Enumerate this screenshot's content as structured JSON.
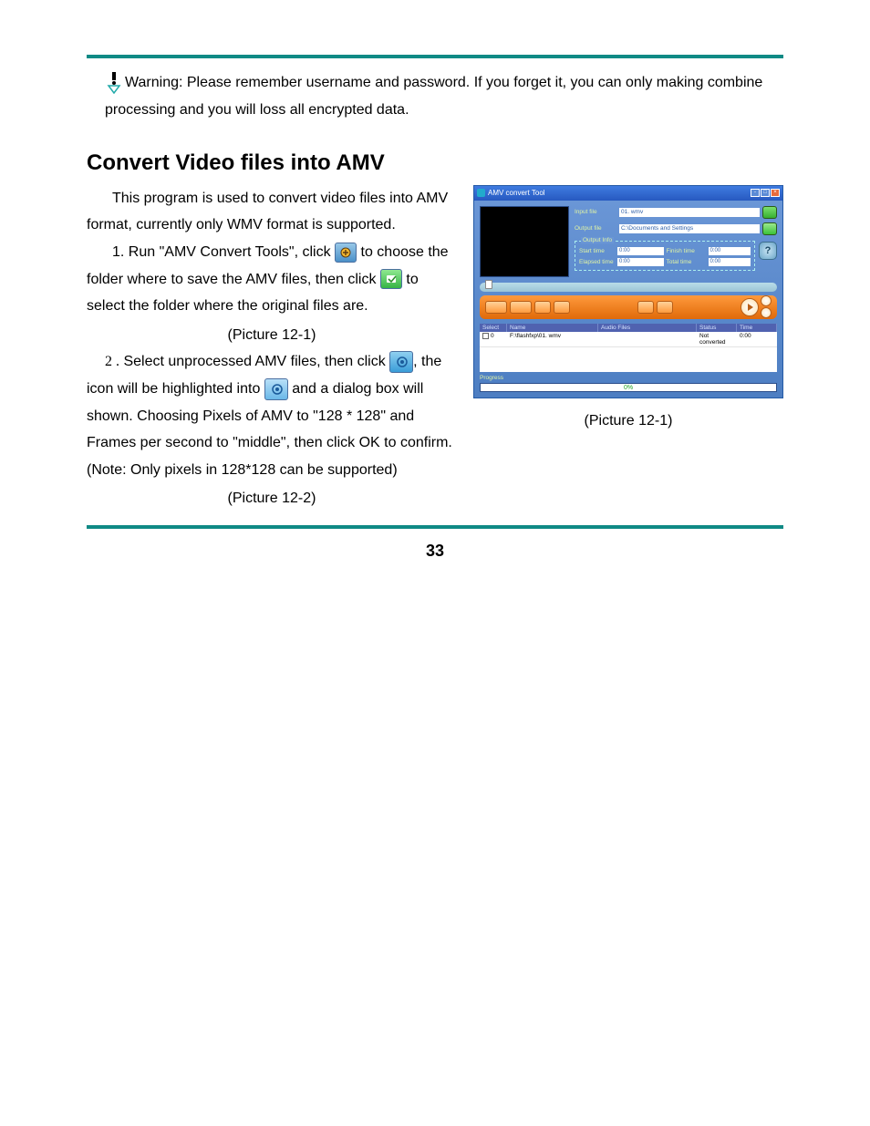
{
  "warning": {
    "text": "Warning: Please remember username and password. If you forget it, you can only making combine processing and you will loss all encrypted data."
  },
  "section_title": "Convert Video files into AMV",
  "body": {
    "intro": "This program is used to convert video files into AMV format, currently only WMV format is supported.",
    "step1_a": "1.    Run \"AMV Convert Tools\", click ",
    "step1_b": " to choose the folder where to save the AMV files, then click ",
    "step1_c": " to select the folder where the original files are.",
    "pic_ref_1": "(Picture 12-1)",
    "step2_num": "2 .",
    "step2_a": " Select unprocessed AMV files, then click",
    "step2_b": ", the icon will be highlighted into ",
    "step2_c": " and a dialog box will shown. Choosing Pixels of AMV to \"128 * 128\" and Frames per second to \"middle\", then click OK to confirm. (Note: Only pixels in 128*128 can be supported)",
    "pic_ref_2": "(Picture 12-2)"
  },
  "figure_caption": "(Picture 12-1)",
  "page_number": "33",
  "app": {
    "title": "AMV convert Tool",
    "input_label": "Input file",
    "input_value": "01. wmv",
    "output_label": "Output file",
    "output_value": "C:\\Documents and Settings",
    "output_info_title": "Output Info",
    "start_label": "Start time",
    "start_val": "0:00",
    "finish_label": "Finish time",
    "finish_val": "0:00",
    "elapsed_label": "Elapsed time",
    "elapsed_val": "0:00",
    "total_label": "Total time",
    "total_val": "0:00",
    "help": "?",
    "cols": {
      "c1": "Select",
      "c2": "Name",
      "c3": "Audio Files",
      "c4": "Status",
      "c5": "Time"
    },
    "row": {
      "select_mark": "0",
      "name": "F:\\flashfxp\\01. wmv",
      "audio": "",
      "status": "Not converted",
      "time": "0:00"
    },
    "progress_label": "Progress",
    "progress_value": "0%"
  }
}
